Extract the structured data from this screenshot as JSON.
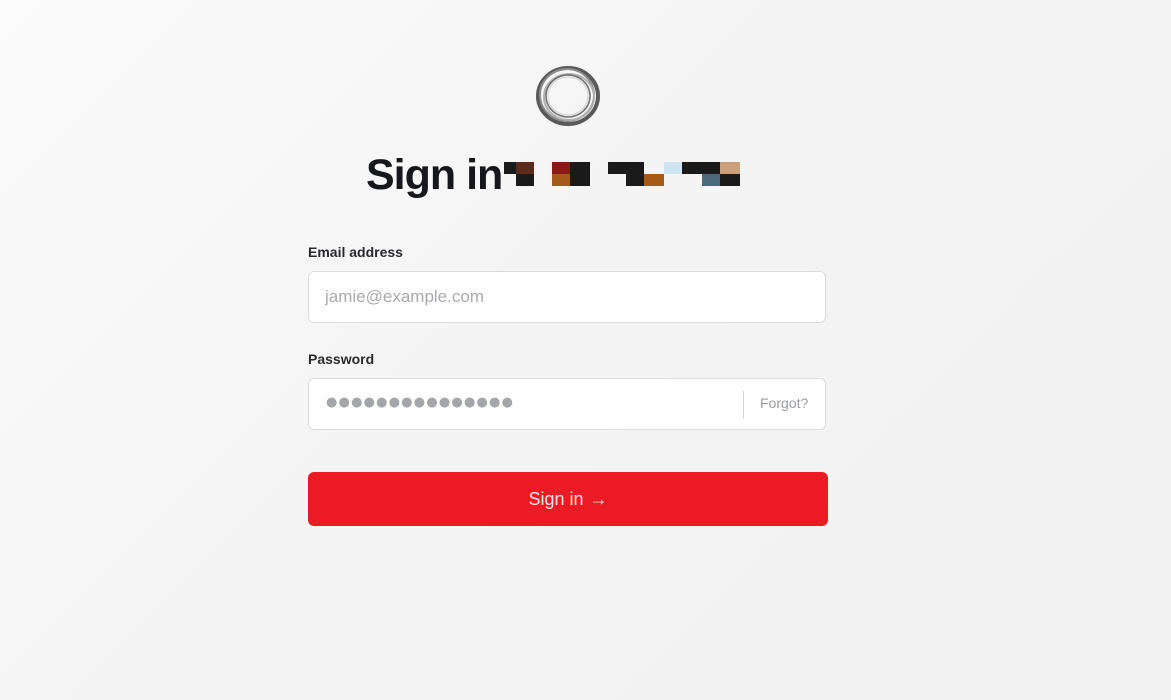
{
  "heading": {
    "title": "Sign in"
  },
  "email": {
    "label": "Email address",
    "placeholder": "jamie@example.com",
    "value": ""
  },
  "password": {
    "label": "Password",
    "masked_value": "●●●●●●●●●●●●●●●",
    "forgot_label": "Forgot?"
  },
  "submit": {
    "label": "Sign in",
    "arrow": "→"
  },
  "colors": {
    "accent": "#ea1b25",
    "background": "#f4f4f4",
    "title": "#16171b"
  },
  "icons": {
    "logo": "ring-logo-icon",
    "submit_arrow": "arrow-right-icon"
  }
}
